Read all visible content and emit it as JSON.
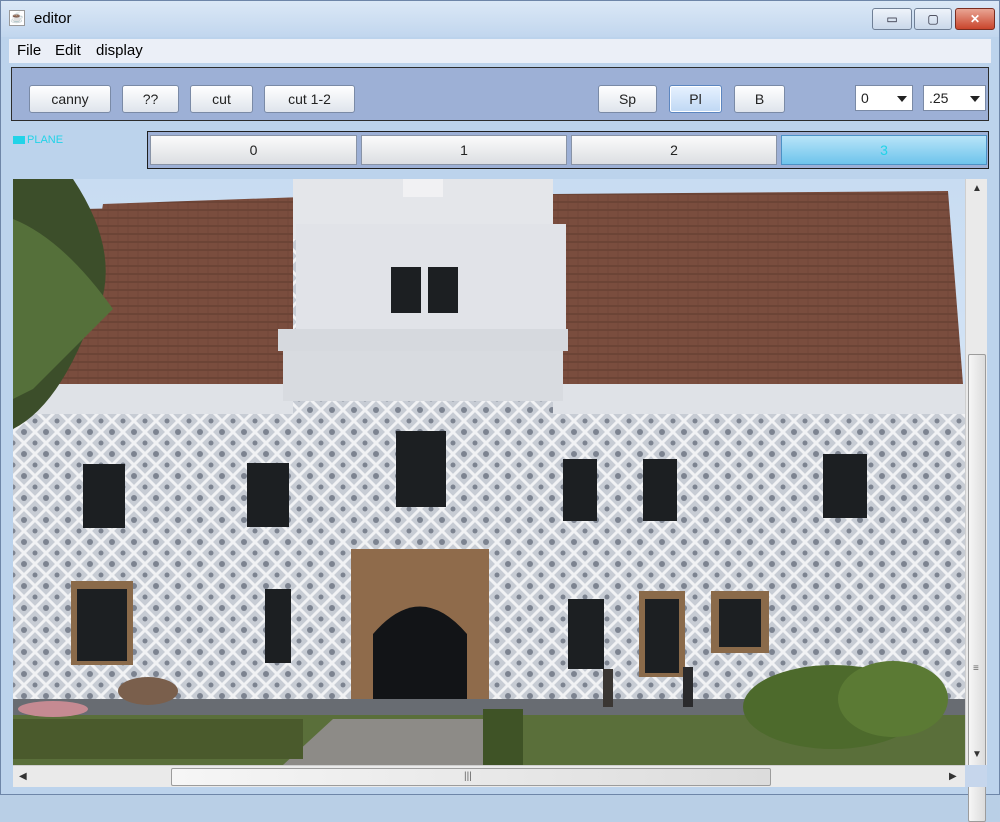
{
  "window": {
    "title": "editor",
    "controls": {
      "minimize": "▭",
      "maximize": "▢",
      "close": "✕"
    }
  },
  "menu": {
    "items": [
      "File",
      "Edit",
      "display"
    ]
  },
  "toolbar": {
    "buttons_left": [
      "canny",
      "??",
      "cut",
      "cut 1-2"
    ],
    "buttons_mid": [
      "Sp",
      "Pl",
      "B"
    ],
    "selected_mid": "Pl",
    "combo_1": "0",
    "combo_2": ".25"
  },
  "plane": {
    "label": "PLANE",
    "tabs": [
      "0",
      "1",
      "2",
      "3"
    ],
    "active_tab": "3"
  },
  "image": {
    "subject": "castle-facade-photo"
  },
  "scrollbars": {
    "vertical_grip": "≡",
    "horizontal_grip": "|||"
  },
  "colors": {
    "accent": "#22d3e8",
    "toolbar_bg": "#9db0d6",
    "window_bg": "#bcd3ec"
  }
}
